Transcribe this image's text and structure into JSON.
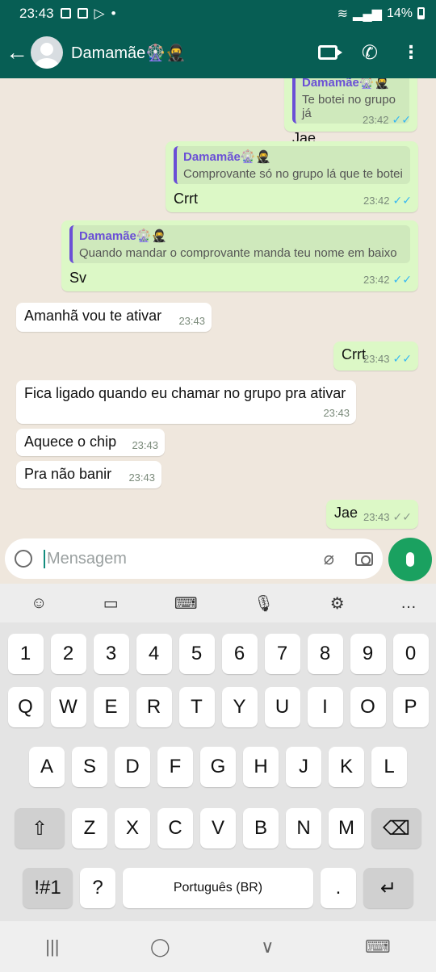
{
  "status": {
    "time": "23:43",
    "battery": "14%"
  },
  "header": {
    "contact_name": "Damamãe🎡🥷"
  },
  "messages": [
    {
      "quote_name": "Damamãe🎡🥷",
      "quote_text": "Te botei no grupo já",
      "text": "Jae",
      "time": "23:42"
    },
    {
      "quote_name": "Damamãe🎡🥷",
      "quote_text": "Comprovante só no grupo lá que te botei",
      "text": "Crrt",
      "time": "23:42"
    },
    {
      "quote_name": "Damamãe🎡🥷",
      "quote_text": "Quando mandar o comprovante manda teu nome em baixo",
      "text": "Sv",
      "time": "23:42"
    },
    {
      "text": "Amanhã vou te ativar",
      "time": "23:43"
    },
    {
      "text": "Crrt",
      "time": "23:43"
    },
    {
      "text": "Fica ligado quando eu chamar no grupo pra ativar",
      "time": "23:43"
    },
    {
      "text": "Aquece o chip",
      "time": "23:43"
    },
    {
      "text": "Pra não banir",
      "time": "23:43"
    },
    {
      "text": "Jae",
      "time": "23:43"
    }
  ],
  "composer": {
    "placeholder": "Mensagem"
  },
  "keyboard": {
    "row_numbers": [
      "1",
      "2",
      "3",
      "4",
      "5",
      "6",
      "7",
      "8",
      "9",
      "0"
    ],
    "row1": [
      "Q",
      "W",
      "E",
      "R",
      "T",
      "Y",
      "U",
      "I",
      "O",
      "P"
    ],
    "row2": [
      "A",
      "S",
      "D",
      "F",
      "G",
      "H",
      "J",
      "K",
      "L"
    ],
    "row3": [
      "Z",
      "X",
      "C",
      "V",
      "B",
      "N",
      "M"
    ],
    "symbols_key": "!#1",
    "question_key": "?",
    "space_label": "Português (BR)",
    "period_key": "."
  }
}
